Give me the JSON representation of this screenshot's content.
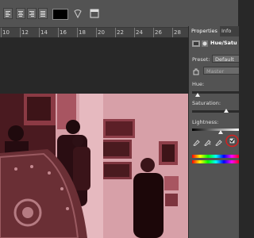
{
  "panel": {
    "tabs": [
      "Properties",
      "Info"
    ],
    "title": "Hue/Satu",
    "preset_label": "Preset:",
    "preset_value": "Default",
    "channel_value": "Master",
    "hue_label": "Hue:",
    "saturation_label": "Saturation:",
    "lightness_label": "Lightness:"
  },
  "ruler": {
    "ticks": [
      "10",
      "12",
      "14",
      "16",
      "18",
      "20",
      "22",
      "24",
      "26",
      "28"
    ]
  },
  "colors": {
    "highlight_circle": "#d42020",
    "photo_tint": "#7a2d34",
    "panel_bg": "#535353"
  },
  "icons": [
    "align-left-icon",
    "align-center-icon",
    "align-right-icon",
    "align-justify-icon",
    "warp-text-icon",
    "panels-icon",
    "adjustment-layer-icon",
    "mask-icon",
    "hand-tool-icon",
    "eyedropper-icon",
    "eyedropper-plus-icon",
    "eyedropper-minus-icon",
    "colorize-checkbox-icon"
  ]
}
